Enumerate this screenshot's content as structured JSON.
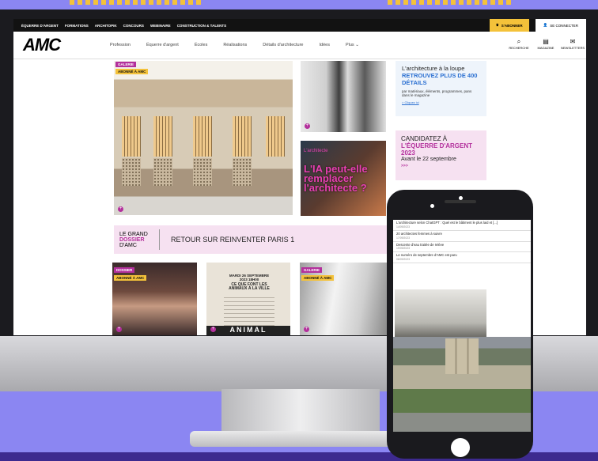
{
  "topbar": {
    "links": [
      "ÉQUERRE D'ARGENT",
      "FORMATIONS",
      "ARCHITOPIK",
      "CONCOURS",
      "WEBINAIRE",
      "CONSTRUCTION & TALENTS"
    ],
    "subscribe": "S'ABONNER",
    "login": "SE CONNECTER"
  },
  "logo": "AMC",
  "nav": {
    "items": [
      "Profession",
      "Équerre d'argent",
      "Écoles",
      "Réalisations",
      "Détails d'architecture",
      "Idées",
      "Plus"
    ],
    "icons": [
      {
        "label": "RECHERCHE",
        "icon": "search-icon"
      },
      {
        "label": "MAGAZINE",
        "icon": "magazine-icon"
      },
      {
        "label": "NEWSLETTERS",
        "icon": "newsletter-icon"
      }
    ]
  },
  "hero": {
    "tag": "GALERIE",
    "badge": "ABONNÉ À AMC"
  },
  "ia": {
    "small": "L'architecte",
    "title": "L'IA peut-elle remplacer l'architecte ?"
  },
  "loupe": {
    "line1": "L'architecture à la loupe",
    "line2": "RETROUVEZ PLUS DE 400 DÉTAILS",
    "line3": "par matériaux, éléments, programmes, pans dans le magazine",
    "link": "> Cliquez ici"
  },
  "candidatez": {
    "line1": "CANDIDATEZ À",
    "line2": "L'ÉQUERRE D'ARGENT 2023",
    "line3": "Avant le 22 septembre",
    "more": ">>>"
  },
  "dossier": {
    "l1": "LE GRAND",
    "l2": "DOSSIER",
    "l3": "D'AMC",
    "link": "RETOUR SUR REINVENTER PARIS 1"
  },
  "cards": [
    {
      "tag": "DOSSIER",
      "badge": "ABONNÉ À AMC"
    },
    {
      "poster_date": "MARDI 26 SEPTEMBRE 2023 18H00",
      "poster_title": "CE QUE FONT LES ANIMAUX À LA VILLE",
      "poster_big": "ANIMAL"
    },
    {
      "tag": "GALERIE",
      "badge": "ABONNÉ À AMC"
    }
  ],
  "phone": {
    "items": [
      {
        "title": "L'architecture selon ChatGPT : Quel est le bâtiment le plus laid et [...]",
        "date": "14/09/2023"
      },
      {
        "title": "20 architectes femmes à suivre",
        "date": "17/09/2023"
      },
      {
        "title": "Descente d'eau traitée de relève",
        "date": "19/09/2023"
      },
      {
        "title": "Le numéro de septembre d'AMC est paru",
        "date": "06/09/2023"
      }
    ]
  },
  "colors": {
    "accent": "#b3309c",
    "yellow": "#f4c23a",
    "background": "#8b86f2",
    "link": "#2a6fd1"
  }
}
